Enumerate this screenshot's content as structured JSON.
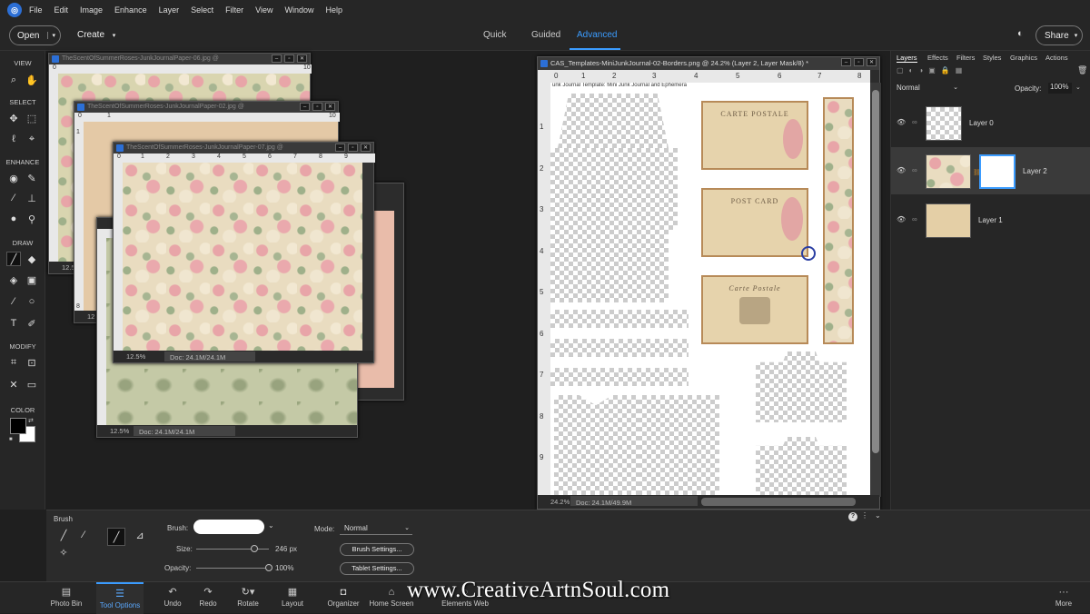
{
  "menu": {
    "items": [
      "File",
      "Edit",
      "Image",
      "Enhance",
      "Layer",
      "Select",
      "Filter",
      "View",
      "Window",
      "Help"
    ]
  },
  "modebar": {
    "open_label": "Open",
    "create_label": "Create",
    "modes": [
      "Quick",
      "Guided",
      "Advanced"
    ],
    "active_mode": "Advanced",
    "share_label": "Share"
  },
  "toolbox": {
    "sections": [
      "VIEW",
      "SELECT",
      "ENHANCE",
      "DRAW",
      "MODIFY",
      "COLOR"
    ],
    "icons": {
      "view": [
        "zoom-icon",
        "hand-icon"
      ],
      "select": [
        "move-icon",
        "marquee-icon",
        "lasso-icon",
        "quick-selection-icon"
      ],
      "enhance": [
        "eye-icon",
        "spot-healing-icon",
        "smart-brush-icon",
        "clone-stamp-icon",
        "blur-icon",
        "sponge-icon"
      ],
      "draw": [
        "brush-icon",
        "eraser-icon",
        "paint-bucket-icon",
        "gradient-icon",
        "eyedropper-icon",
        "shape-icon",
        "type-icon",
        "pencil-icon"
      ],
      "modify": [
        "crop-icon",
        "recompose-icon",
        "content-aware-move-icon",
        "straighten-icon"
      ]
    },
    "foreground_color": "#000000",
    "background_color": "#ffffff"
  },
  "windows": {
    "w1": {
      "title": "TheScentOfSummerRoses-JunkJournalPaper-06.jpg @",
      "zoom": "12.5"
    },
    "w2": {
      "title": "TheScentOfSummerRoses-JunkJournalPaper-02.jpg @",
      "zoom": "12"
    },
    "w3": {
      "title": "TheScentOfSummerRoses-JunkJournalPaper-07.jpg @",
      "zoom": "12.5%",
      "doc": "Doc: 24.1M/24.1M"
    },
    "w4": {
      "zoom": "12.5%",
      "doc": "Doc: 24.1M/24.1M"
    },
    "main": {
      "title": "CAS_Templates-MiniJunkJournal-02-Borders.png @ 24.2% (Layer 2, Layer Mask/8) *",
      "caption": "unk Journal Template: Mini Junk Journal and Ephemera",
      "zoom": "24.2%",
      "doc": "Doc: 24.1M/49.9M",
      "postcards": [
        "CARTE POSTALE",
        "POST CARD",
        "Carte Postale"
      ]
    },
    "ruler_numbers": [
      "0",
      "1",
      "2",
      "3",
      "4",
      "5",
      "6",
      "7",
      "8",
      "9",
      "10"
    ],
    "main_ruler_top": [
      "0",
      "1",
      "2",
      "3",
      "4",
      "5",
      "6",
      "7",
      "8"
    ],
    "main_ruler_left": [
      "1",
      "2",
      "3",
      "4",
      "5",
      "6",
      "7",
      "8",
      "9"
    ],
    "w2_ruler_left": [
      "0",
      "1",
      "2",
      "3",
      "4",
      "5",
      "6",
      "7",
      "8"
    ]
  },
  "layers_panel": {
    "tabs": [
      "Layers",
      "Effects",
      "Filters",
      "Styles",
      "Graphics",
      "Actions"
    ],
    "blend_mode": "Normal",
    "opacity_label": "Opacity:",
    "opacity_value": "100%",
    "layers": [
      {
        "name": "Layer 0"
      },
      {
        "name": "Layer 2"
      },
      {
        "name": "Layer 1"
      }
    ]
  },
  "tool_options": {
    "tool_name": "Brush",
    "brush_label": "Brush:",
    "size_label": "Size:",
    "size_value": "246 px",
    "size_fraction": 0.8,
    "opacity_label": "Opacity:",
    "opacity_value": "100%",
    "opacity_fraction": 1.0,
    "mode_label": "Mode:",
    "mode_value": "Normal",
    "brush_settings_label": "Brush Settings...",
    "tablet_settings_label": "Tablet Settings..."
  },
  "taskbar": {
    "items": [
      {
        "label": "Photo Bin",
        "icon": "photo-bin-icon"
      },
      {
        "label": "Tool Options",
        "icon": "tool-options-icon"
      },
      {
        "label": "Undo",
        "icon": "undo-icon"
      },
      {
        "label": "Redo",
        "icon": "redo-icon"
      },
      {
        "label": "Rotate",
        "icon": "rotate-icon"
      },
      {
        "label": "Layout",
        "icon": "layout-icon"
      },
      {
        "label": "Organizer",
        "icon": "organizer-icon"
      },
      {
        "label": "Home Screen",
        "icon": "home-icon"
      },
      {
        "label": "Elements Web",
        "icon": "elements-web-icon"
      },
      {
        "label": "More",
        "icon": "more-icon"
      }
    ],
    "active": "Tool Options"
  },
  "watermark": "www.CreativeArtnSoul.com",
  "colors": {
    "accent": "#3b9cff",
    "panel": "#262626"
  }
}
